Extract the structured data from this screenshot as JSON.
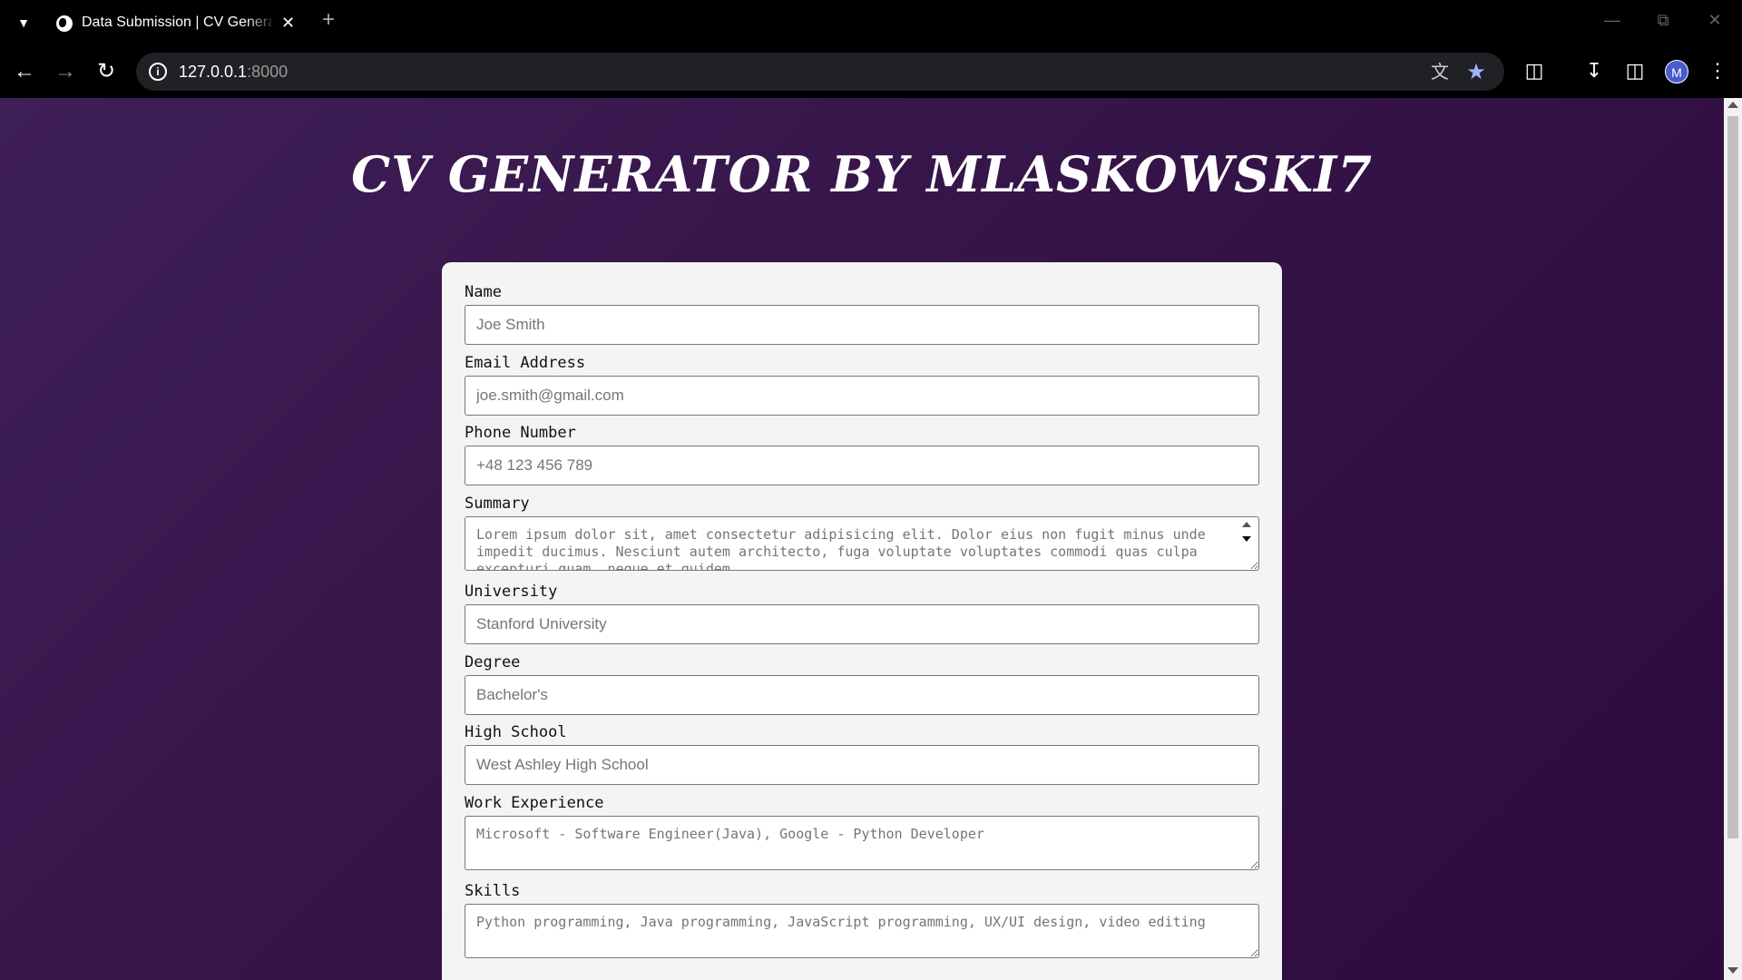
{
  "browser": {
    "tab_title": "Data Submission | CV Generator",
    "new_tab_label": "+",
    "url_host": "127.0.0.1",
    "url_port": ":8000",
    "avatar_letter": "M"
  },
  "page": {
    "title": "CV GENERATOR BY MLASKOWSKI7"
  },
  "form": {
    "name": {
      "label": "Name",
      "placeholder": "Joe Smith"
    },
    "email": {
      "label": "Email Address",
      "placeholder": "joe.smith@gmail.com"
    },
    "phone": {
      "label": "Phone Number",
      "placeholder": "+48 123 456 789"
    },
    "summary": {
      "label": "Summary",
      "placeholder": "Lorem ipsum dolor sit, amet consectetur adipisicing elit. Dolor eius non fugit minus unde impedit ducimus. Nesciunt autem architecto, fuga voluptate voluptates commodi quas culpa excepturi quam, neque et quidem."
    },
    "university": {
      "label": "University",
      "placeholder": "Stanford University"
    },
    "degree": {
      "label": "Degree",
      "placeholder": "Bachelor's"
    },
    "high_school": {
      "label": "High School",
      "placeholder": "West Ashley High School"
    },
    "work_experience": {
      "label": "Work Experience",
      "placeholder": "Microsoft - Software Engineer(Java), Google - Python Developer"
    },
    "skills": {
      "label": "Skills",
      "placeholder": "Python programming, Java programming, JavaScript programming, UX/UI design, video editing"
    }
  },
  "colors": {
    "background_start": "#3e1f56",
    "background_end": "#2d0b40",
    "card": "#f4f4f4"
  },
  "icons": {
    "tab_search": "chevron-down-icon",
    "favicon": "globe-icon",
    "back": "arrow-left-icon",
    "forward": "arrow-right-icon",
    "reload": "reload-icon",
    "site_info": "info-icon",
    "translate": "translate-icon",
    "bookmark": "star-icon",
    "extensions": "puzzle-icon",
    "downloads": "download-icon",
    "side_panel": "side-panel-icon",
    "menu": "kebab-menu-icon"
  }
}
